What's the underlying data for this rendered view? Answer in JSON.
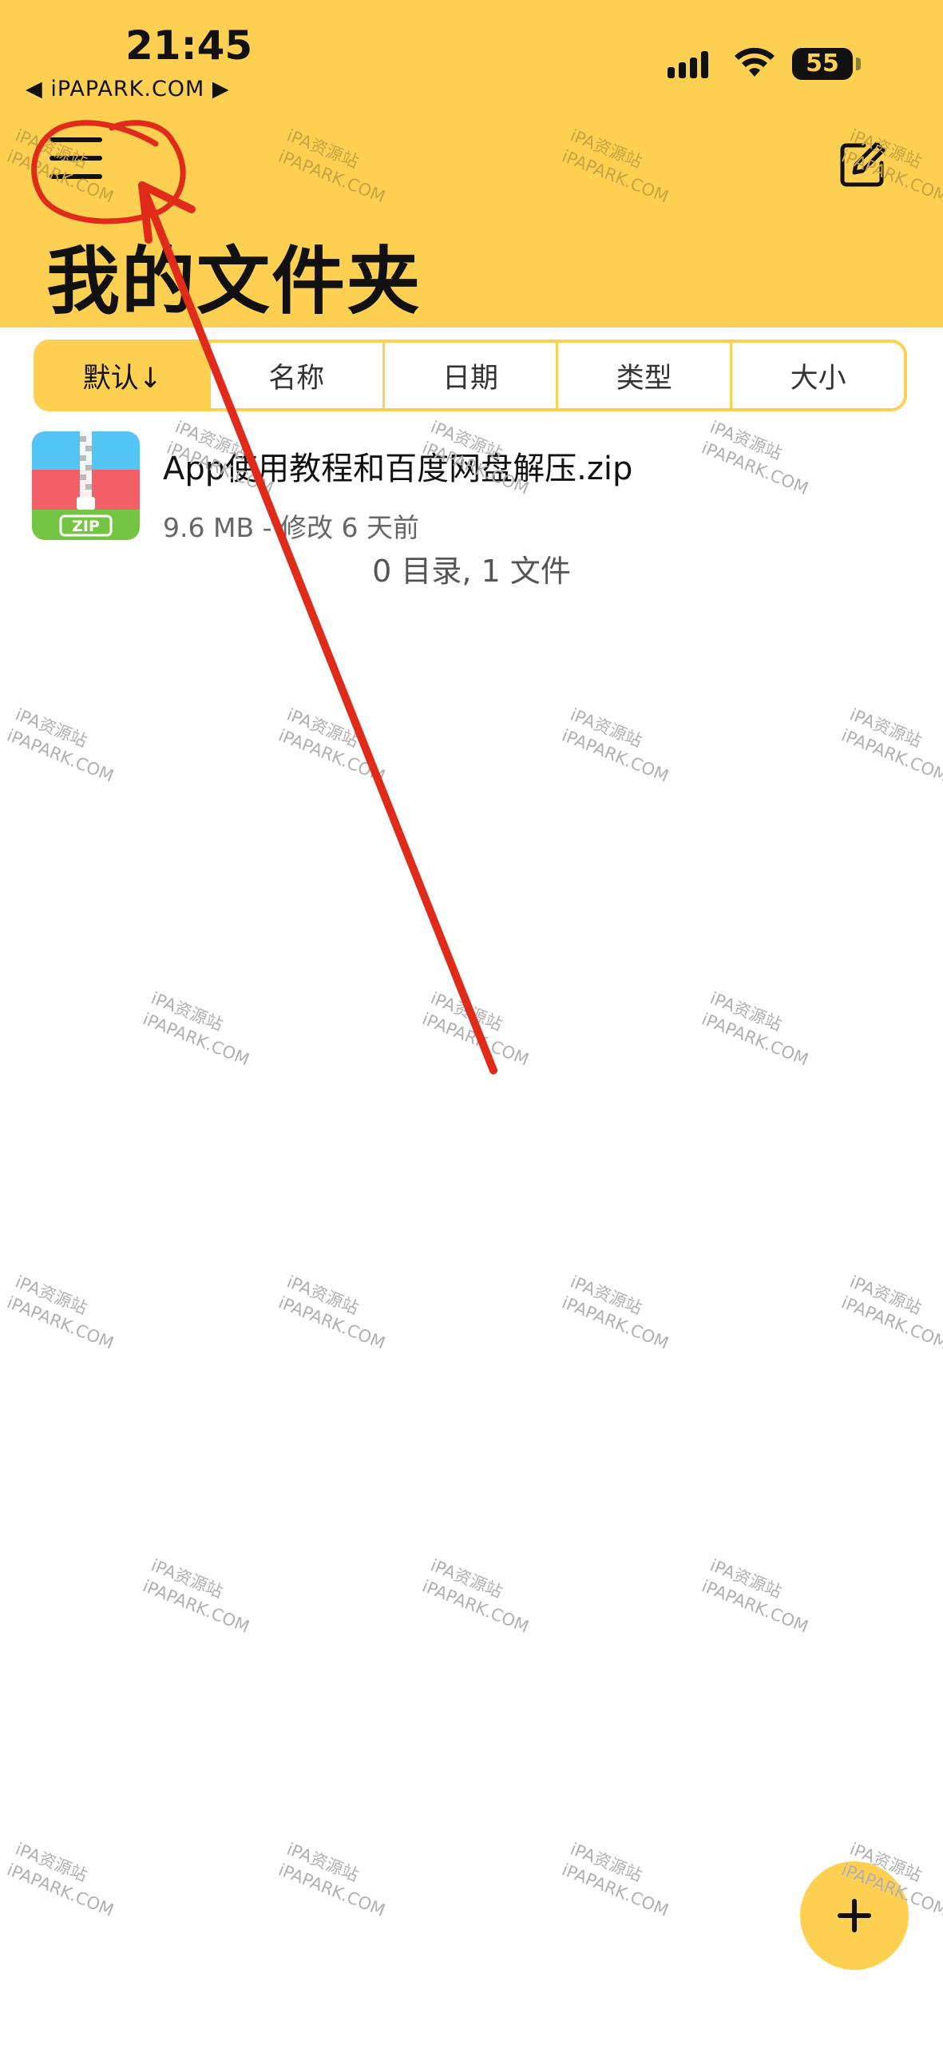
{
  "status_bar": {
    "time": "21:45",
    "back_label": "◀ iPAPARK.COM ▶",
    "battery": "55",
    "signal_icon": "signal-bars-icon",
    "wifi_icon": "wifi-icon"
  },
  "header": {
    "menu_icon": "hamburger-menu-icon",
    "edit_icon": "compose-icon",
    "title": "我的文件夹"
  },
  "sort_tabs": [
    {
      "label": "默认↓",
      "active": true
    },
    {
      "label": "名称",
      "active": false
    },
    {
      "label": "日期",
      "active": false
    },
    {
      "label": "类型",
      "active": false
    },
    {
      "label": "大小",
      "active": false
    }
  ],
  "files": [
    {
      "name": "App使用教程和百度网盘解压.zip",
      "meta": "9.6 MB - 修改 6 天前",
      "icon": "zip-archive-icon",
      "icon_label": "ZIP"
    }
  ],
  "summary": "0 目录, 1 文件",
  "watermark": {
    "line1": "iPA资源站",
    "line2": "iPAPARK.COM"
  },
  "fab": {
    "icon": "plus-icon"
  },
  "colors": {
    "accent": "#FDD052",
    "zip_blue": "#52C5F5",
    "zip_red": "#F35F66",
    "zip_green": "#73C543",
    "annotation_red": "#E02A1A"
  }
}
